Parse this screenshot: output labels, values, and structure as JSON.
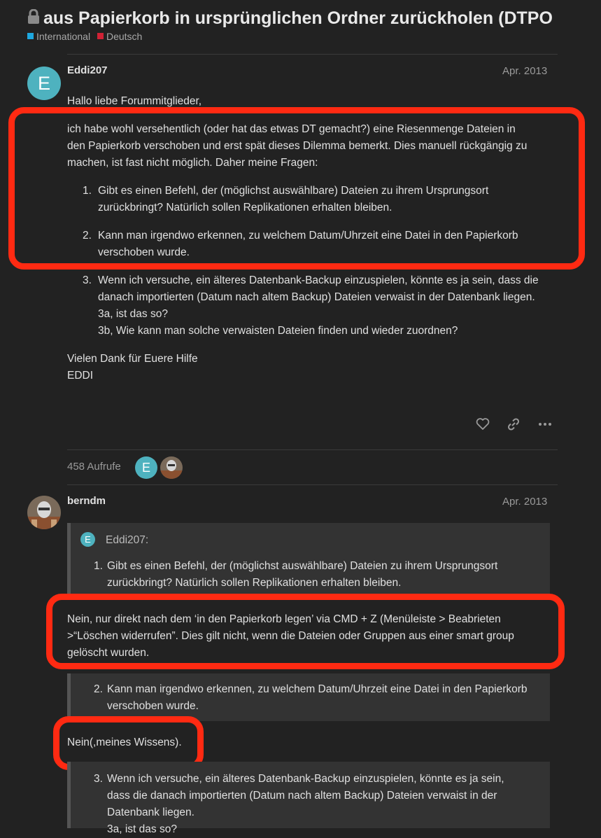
{
  "topic": {
    "title": "aus Papierkorb in ursprünglichen Ordner zurückholen (DTPO",
    "categories": [
      {
        "label": "International",
        "color": "#1ea8e0"
      },
      {
        "label": "Deutsch",
        "color": "#d02235"
      }
    ]
  },
  "post1": {
    "avatar_letter": "E",
    "username": "Eddi207",
    "date": "Apr. 2013",
    "greeting": "Hallo liebe Forummitglieder,",
    "intro": [
      "ich habe wohl versehentlich (oder hat das etwas DT gemacht?) eine Riesenmenge Dateien in",
      "den Papierkorb verschoben und erst spät dieses Dilemma bemerkt. Dies manuell rückgängig zu",
      "machen, ist fast nicht möglich. Daher meine Fragen:"
    ],
    "q1": {
      "num": "1.",
      "lines": [
        "Gibt es einen Befehl, der (möglichst auswählbare) Dateien zu ihrem Ursprungsort",
        "zurückbringt? Natürlich sollen Replikationen erhalten bleiben."
      ]
    },
    "q2": {
      "num": "2.",
      "lines": [
        "Kann man irgendwo erkennen, zu welchem Datum/Uhrzeit eine Datei in den Papierkorb",
        "verschoben wurde."
      ]
    },
    "q3": {
      "num": "3.",
      "lines": [
        "Wenn ich versuche, ein älteres Datenbank-Backup einzuspielen, könnte es ja sein, dass die",
        "danach importierten (Datum nach altem Backup) Dateien verwaist in der Datenbank liegen.",
        "3a, ist das so?",
        "3b, Wie kann man solche verwaisten Dateien finden und wieder zuordnen?"
      ]
    },
    "closing": [
      "Vielen Dank für Euere Hilfe",
      "EDDI"
    ]
  },
  "topic_footer": {
    "views": "458 Aufrufe",
    "participant_letter": "E"
  },
  "post2": {
    "username": "berndm",
    "date": "Apr. 2013",
    "quote_author": "Eddi207:",
    "quote_avatar_letter": "E",
    "quote1": {
      "num": "1.",
      "lines": [
        "Gibt es einen Befehl, der (möglichst auswählbare) Dateien zu ihrem Ursprungsort",
        "zurückbringt? Natürlich sollen Replikationen erhalten bleiben."
      ]
    },
    "answer1": [
      "Nein, nur direkt nach dem ‘in den Papierkorb legen’ via CMD + Z (Menüleiste > Beabrieten",
      ">“Löschen widerrufen”. Dies gilt nicht, wenn die Dateien oder Gruppen aus einer smart group",
      "gelöscht wurden."
    ],
    "quote2": {
      "num": "2.",
      "lines": [
        "Kann man irgendwo erkennen, zu welchem Datum/Uhrzeit eine Datei in den Papierkorb",
        "verschoben wurde."
      ]
    },
    "answer2": "Nein(,meines Wissens).",
    "quote3": {
      "num": "3.",
      "lines": [
        "Wenn ich versuche, ein älteres Datenbank-Backup einzuspielen, könnte es ja sein,",
        "dass die danach importierten (Datum nach altem Backup) Dateien verwaist in der",
        "Datenbank liegen.",
        "3a, ist das so?"
      ]
    }
  },
  "icons": [
    "lock-icon",
    "heart-icon",
    "link-icon",
    "more-icon"
  ],
  "colors": {
    "background": "#222222",
    "highlight_box": "#ff2a12",
    "avatar": "#4eb2bf",
    "quote_bg": "#333333"
  }
}
